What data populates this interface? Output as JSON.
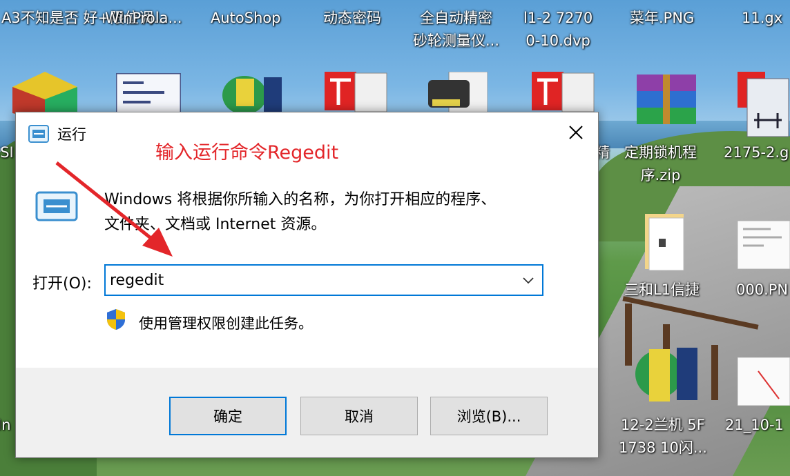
{
  "desktop": {
    "icons": [
      {
        "label": "A3不知是否\n好+限位调...",
        "icon": "text-file-icon"
      },
      {
        "label": "WinProla...",
        "icon": "app-icon"
      },
      {
        "label": "AutoShop",
        "icon": "plc-app-icon"
      },
      {
        "label": "动态密码",
        "icon": "file-icon"
      },
      {
        "label": "全自动精密\n砂轮测量仪...",
        "icon": "file-icon"
      },
      {
        "label": "l1-2 7270\n0-10.dvp",
        "icon": "dvp-file-icon"
      },
      {
        "label": "菜年.PNG",
        "icon": "image-file-icon"
      },
      {
        "label": "11.gx",
        "icon": "gx-file-icon"
      },
      {
        "label": "定期锁机程\n序.zip",
        "icon": "winrar-archive-icon"
      },
      {
        "label": "2175-2.g",
        "icon": "ladder-file-icon"
      },
      {
        "label": "三和L1信捷",
        "icon": "folder-icon"
      },
      {
        "label": "000.PN",
        "icon": "image-file-icon"
      },
      {
        "label": "12-2兰机 5F\n1738 10闪...",
        "icon": "plc-app-icon"
      },
      {
        "label": "21_10-1",
        "icon": "image-file-icon"
      },
      {
        "label": "精",
        "icon": "partial-label"
      },
      {
        "label": "ISI",
        "icon": "partial-label"
      },
      {
        "label": "In",
        "icon": "partial-label"
      }
    ]
  },
  "dialog": {
    "title": "运行",
    "annotation": "输入运行命令Regedit",
    "description_line1": "Windows 将根据你所输入的名称，为你打开相应的程序、",
    "description_line2": "文件夹、文档或 Internet 资源。",
    "open_label": "打开(O):",
    "open_value": "regedit",
    "admin_note": "使用管理权限创建此任务。",
    "buttons": {
      "ok": "确定",
      "cancel": "取消",
      "browse": "浏览(B)..."
    },
    "colors": {
      "annotation": "#e3262a",
      "focus_border": "#0078d7",
      "button_bar": "#f0f0f0"
    }
  }
}
